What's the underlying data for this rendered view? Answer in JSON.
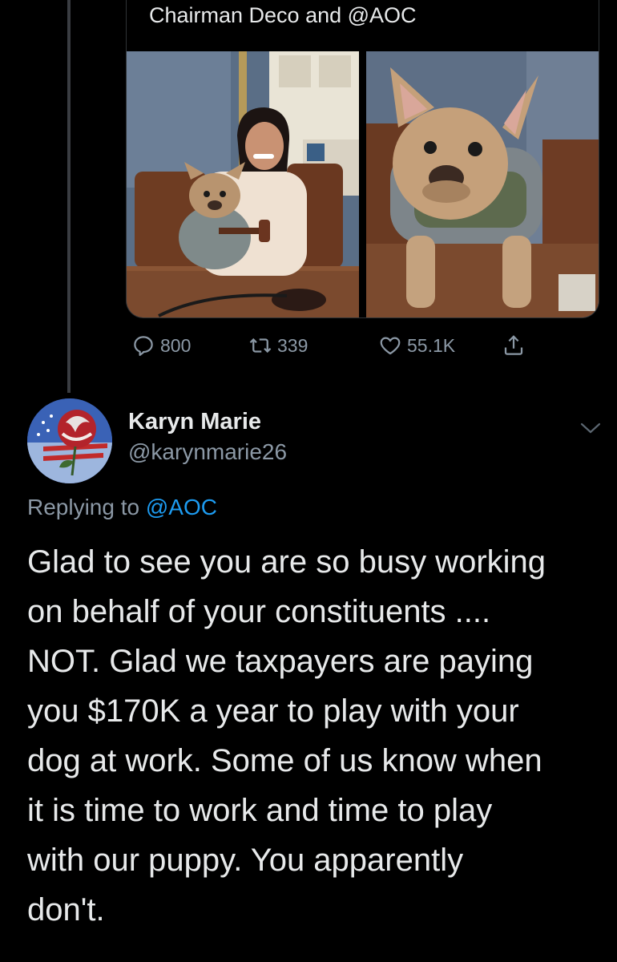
{
  "quoted_tweet": {
    "text": "Chairman Deco and @AOC",
    "media": [
      {
        "alt_icon": "photo-woman-with-dog-at-desk"
      },
      {
        "alt_icon": "photo-dog-on-desk"
      }
    ],
    "actions": {
      "replies": "800",
      "retweets": "339",
      "likes": "55.1K"
    }
  },
  "reply": {
    "display_name": "Karyn Marie",
    "handle": "@karynmarie26",
    "replying_to_prefix": "Replying to ",
    "replying_to_handle": "@AOC",
    "body": "Glad to see you are so busy working\non behalf of your constituents ....\nNOT.  Glad we taxpayers are paying\nyou $170K a year to play with your\ndog at work.  Some of us know when\nit is time to work and time to play\nwith our puppy.  You apparently\ndon't."
  },
  "colors": {
    "background": "#000000",
    "text_primary": "#e7e9ea",
    "text_secondary": "#8b98a5",
    "link": "#1d9bf0",
    "thread_line": "#3a3d42"
  },
  "icons": [
    "reply-icon",
    "retweet-icon",
    "like-icon",
    "share-icon",
    "chevron-down-icon"
  ]
}
